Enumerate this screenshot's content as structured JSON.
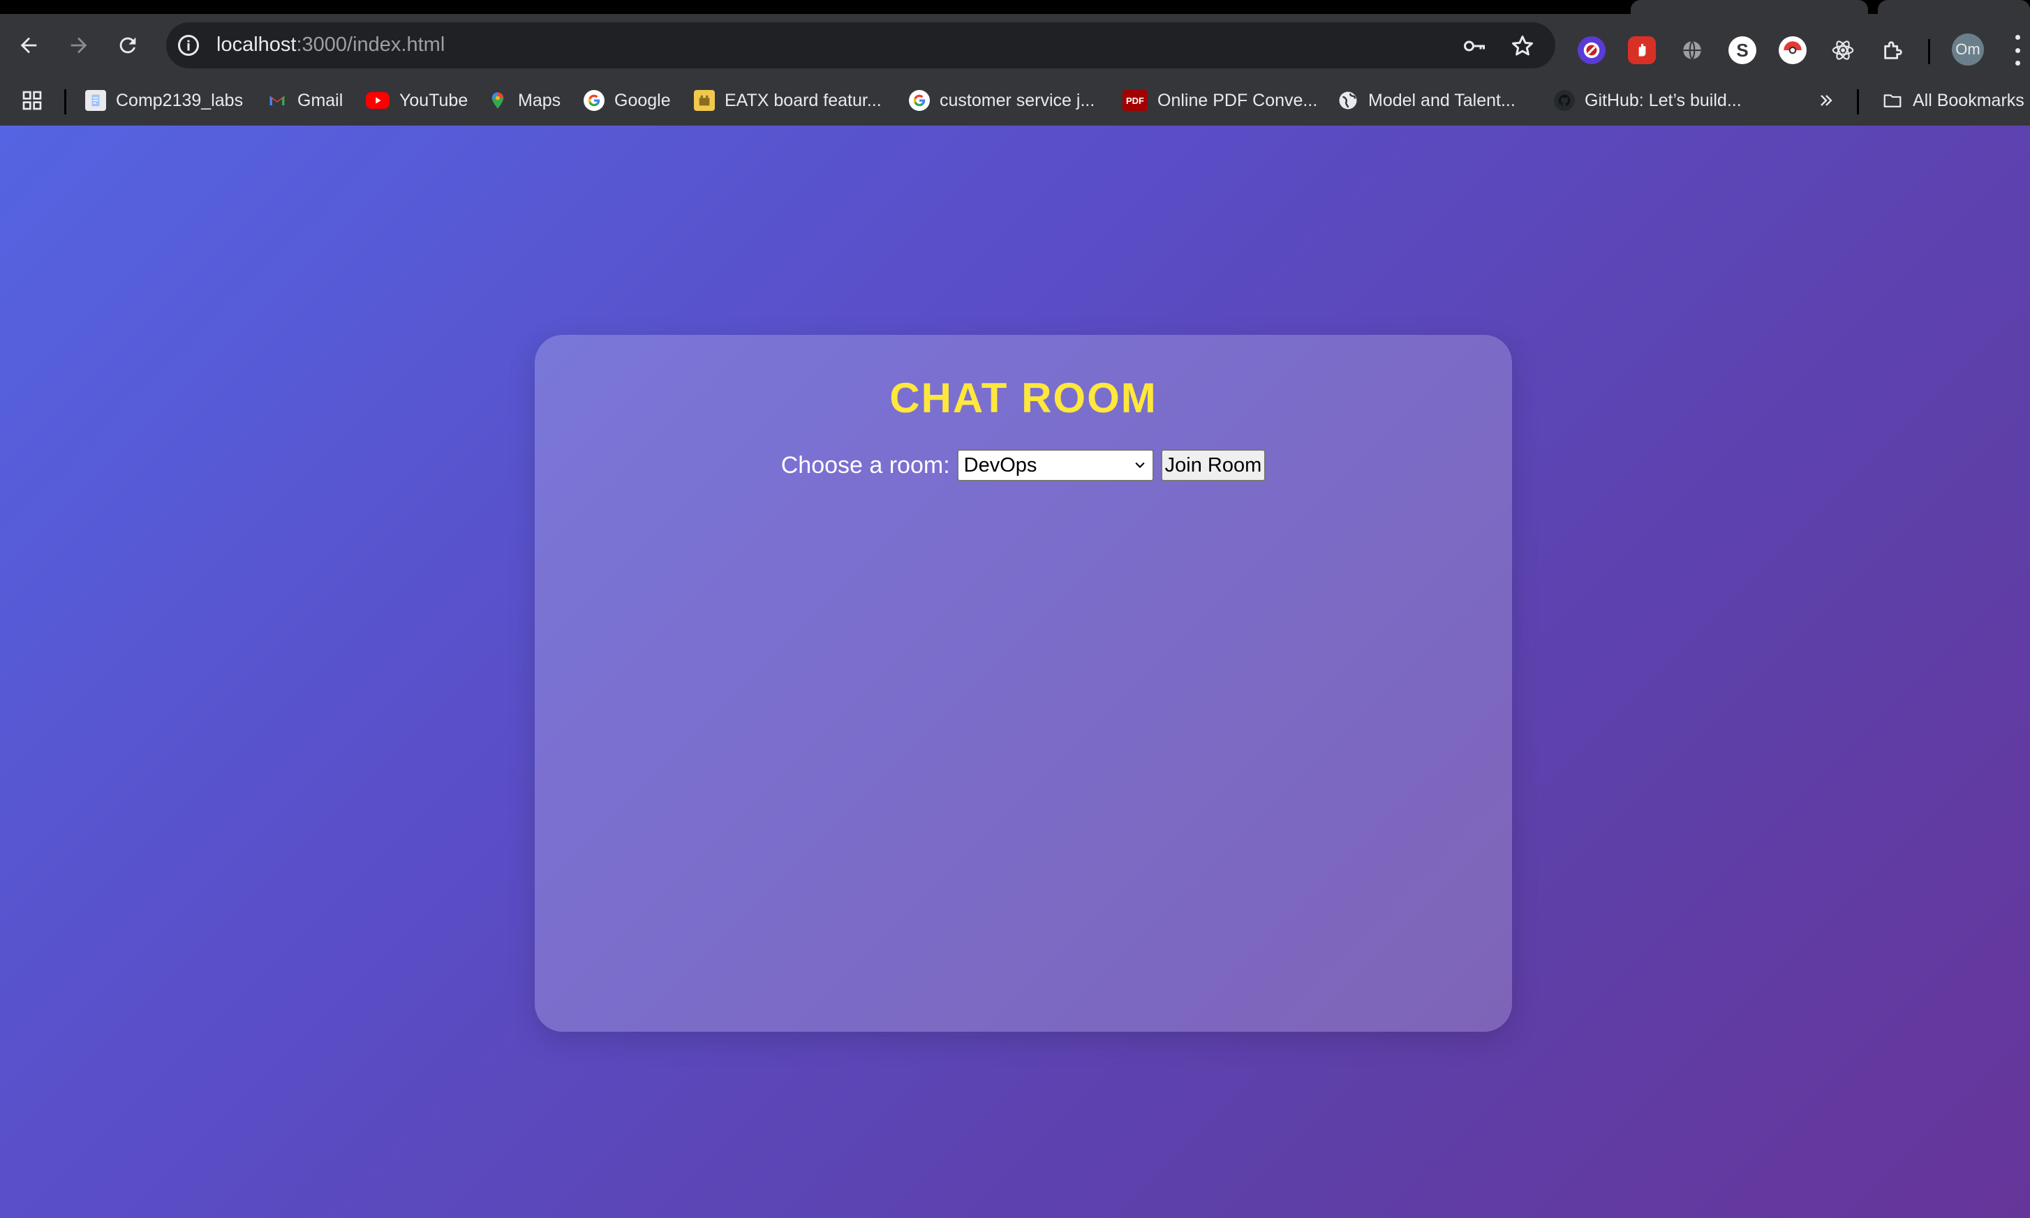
{
  "browser": {
    "url_host": "localhost",
    "url_rest": ":3000/index.html",
    "profile_initials": "Om",
    "bookmarks": [
      {
        "label": "Comp2139_labs",
        "icon": "document-icon"
      },
      {
        "label": "Gmail",
        "icon": "gmail-icon"
      },
      {
        "label": "YouTube",
        "icon": "youtube-icon"
      },
      {
        "label": "Maps",
        "icon": "maps-icon"
      },
      {
        "label": "Google",
        "icon": "google-icon"
      },
      {
        "label": "EATX board featur...",
        "icon": "board-icon"
      },
      {
        "label": "customer service j...",
        "icon": "google-icon"
      },
      {
        "label": "Online PDF Conve...",
        "icon": "pdf-icon",
        "icon_text": "PDF"
      },
      {
        "label": "Model and Talent...",
        "icon": "globe-icon"
      },
      {
        "label": "GitHub: Let’s build...",
        "icon": "github-icon"
      }
    ],
    "all_bookmarks_label": "All Bookmarks"
  },
  "page": {
    "title": "CHAT ROOM",
    "room_label": "Choose a room:",
    "selected_room": "DevOps",
    "join_button": "Join Room"
  },
  "colors": {
    "title": "#ffe83b",
    "gradient_start": "#5564e2",
    "gradient_end": "#66359a"
  }
}
